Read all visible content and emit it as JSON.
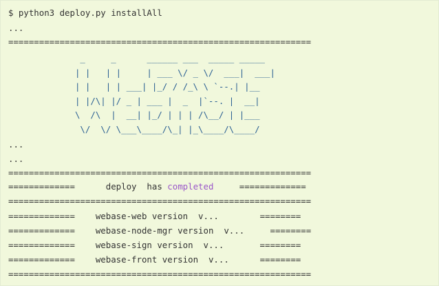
{
  "terminal": {
    "command": "$ python3 deploy.py installAll",
    "ellipsis": "...",
    "separator": "===========================================================",
    "banner": [
      "              _     _      ______ ___  _____ _____",
      "             | |   | |     | ___ \\/ _ \\/  ___|  ___|",
      "             | |   | | ___| |_/ / /_\\ \\ `--.| |__",
      "             | |/\\| |/ _ | ___ |  _  |`--. |  __|",
      "             \\  /\\  |  __| |_/ | | | /\\__/ | |___",
      "              \\/  \\/ \\___\\____/\\_| |_\\____/\\____/"
    ],
    "status": {
      "prefix_bar": "=============",
      "gap_before": "      ",
      "text_before": "deploy  has ",
      "highlight": "completed",
      "gap_after": "     ",
      "suffix_bar": "============="
    },
    "versions": [
      {
        "bar": "=============",
        "gap": "    ",
        "text": "webase-web version  v...",
        "pad": "        ",
        "tail": "========"
      },
      {
        "bar": "=============",
        "gap": "    ",
        "text": "webase-node-mgr version  v...",
        "pad": "     ",
        "tail": "========"
      },
      {
        "bar": "=============",
        "gap": "    ",
        "text": "webase-sign version  v...",
        "pad": "       ",
        "tail": "========"
      },
      {
        "bar": "=============",
        "gap": "    ",
        "text": "webase-front version  v...",
        "pad": "      ",
        "tail": "========"
      }
    ],
    "colors": {
      "background": "#f1f8dc",
      "text": "#333333",
      "banner": "#2a5f93",
      "highlight": "#9a56c9"
    }
  }
}
